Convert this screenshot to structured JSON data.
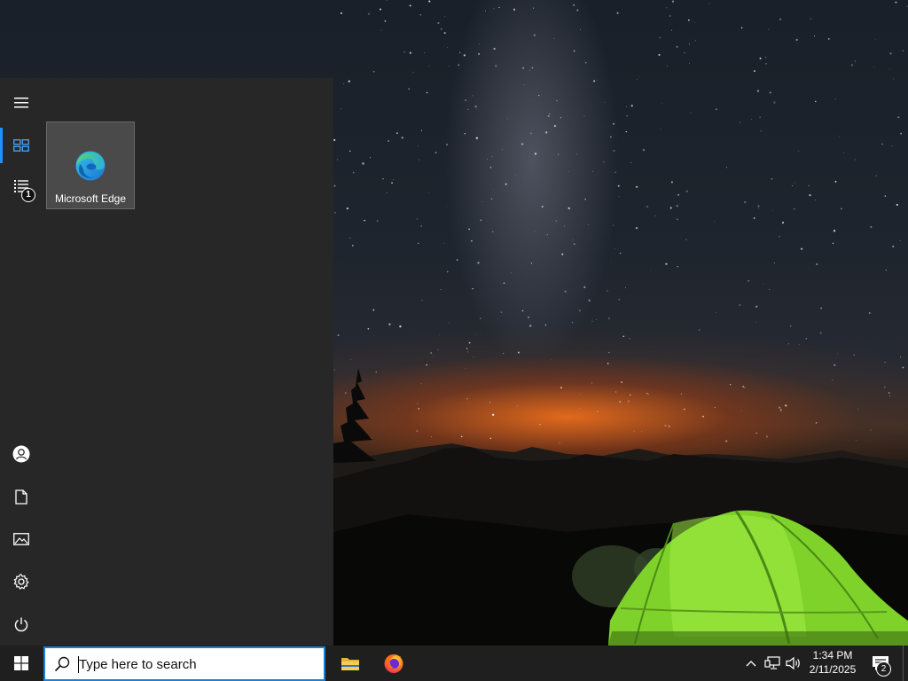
{
  "start_menu": {
    "rail": [
      {
        "name": "expand",
        "icon": "hamburger-icon"
      },
      {
        "name": "tiles",
        "icon": "tiles-icon",
        "active": true
      },
      {
        "name": "all-apps",
        "icon": "list-icon",
        "badge": "1"
      }
    ],
    "rail_bottom": [
      {
        "name": "account",
        "icon": "user-icon"
      },
      {
        "name": "documents",
        "icon": "document-icon"
      },
      {
        "name": "pictures",
        "icon": "picture-icon"
      },
      {
        "name": "settings",
        "icon": "gear-icon"
      },
      {
        "name": "power",
        "icon": "power-icon"
      }
    ],
    "tiles": [
      {
        "label": "Microsoft Edge",
        "icon": "edge-icon"
      }
    ]
  },
  "taskbar": {
    "search_placeholder": "Type here to search",
    "pinned": [
      {
        "name": "File Explorer",
        "icon": "folder-icon"
      },
      {
        "name": "Firefox",
        "icon": "firefox-icon"
      }
    ],
    "tray": {
      "time": "1:34 PM",
      "date": "2/11/2025",
      "notification_count": "2"
    }
  },
  "colors": {
    "accent": "#1e90ff",
    "start_menu_bg": "#282828",
    "taskbar_bg": "#1f1f1f",
    "tile_bg": "#4a4a4a",
    "tent_green": "#7fd22a",
    "horizon_glow": "#e86c1c"
  }
}
